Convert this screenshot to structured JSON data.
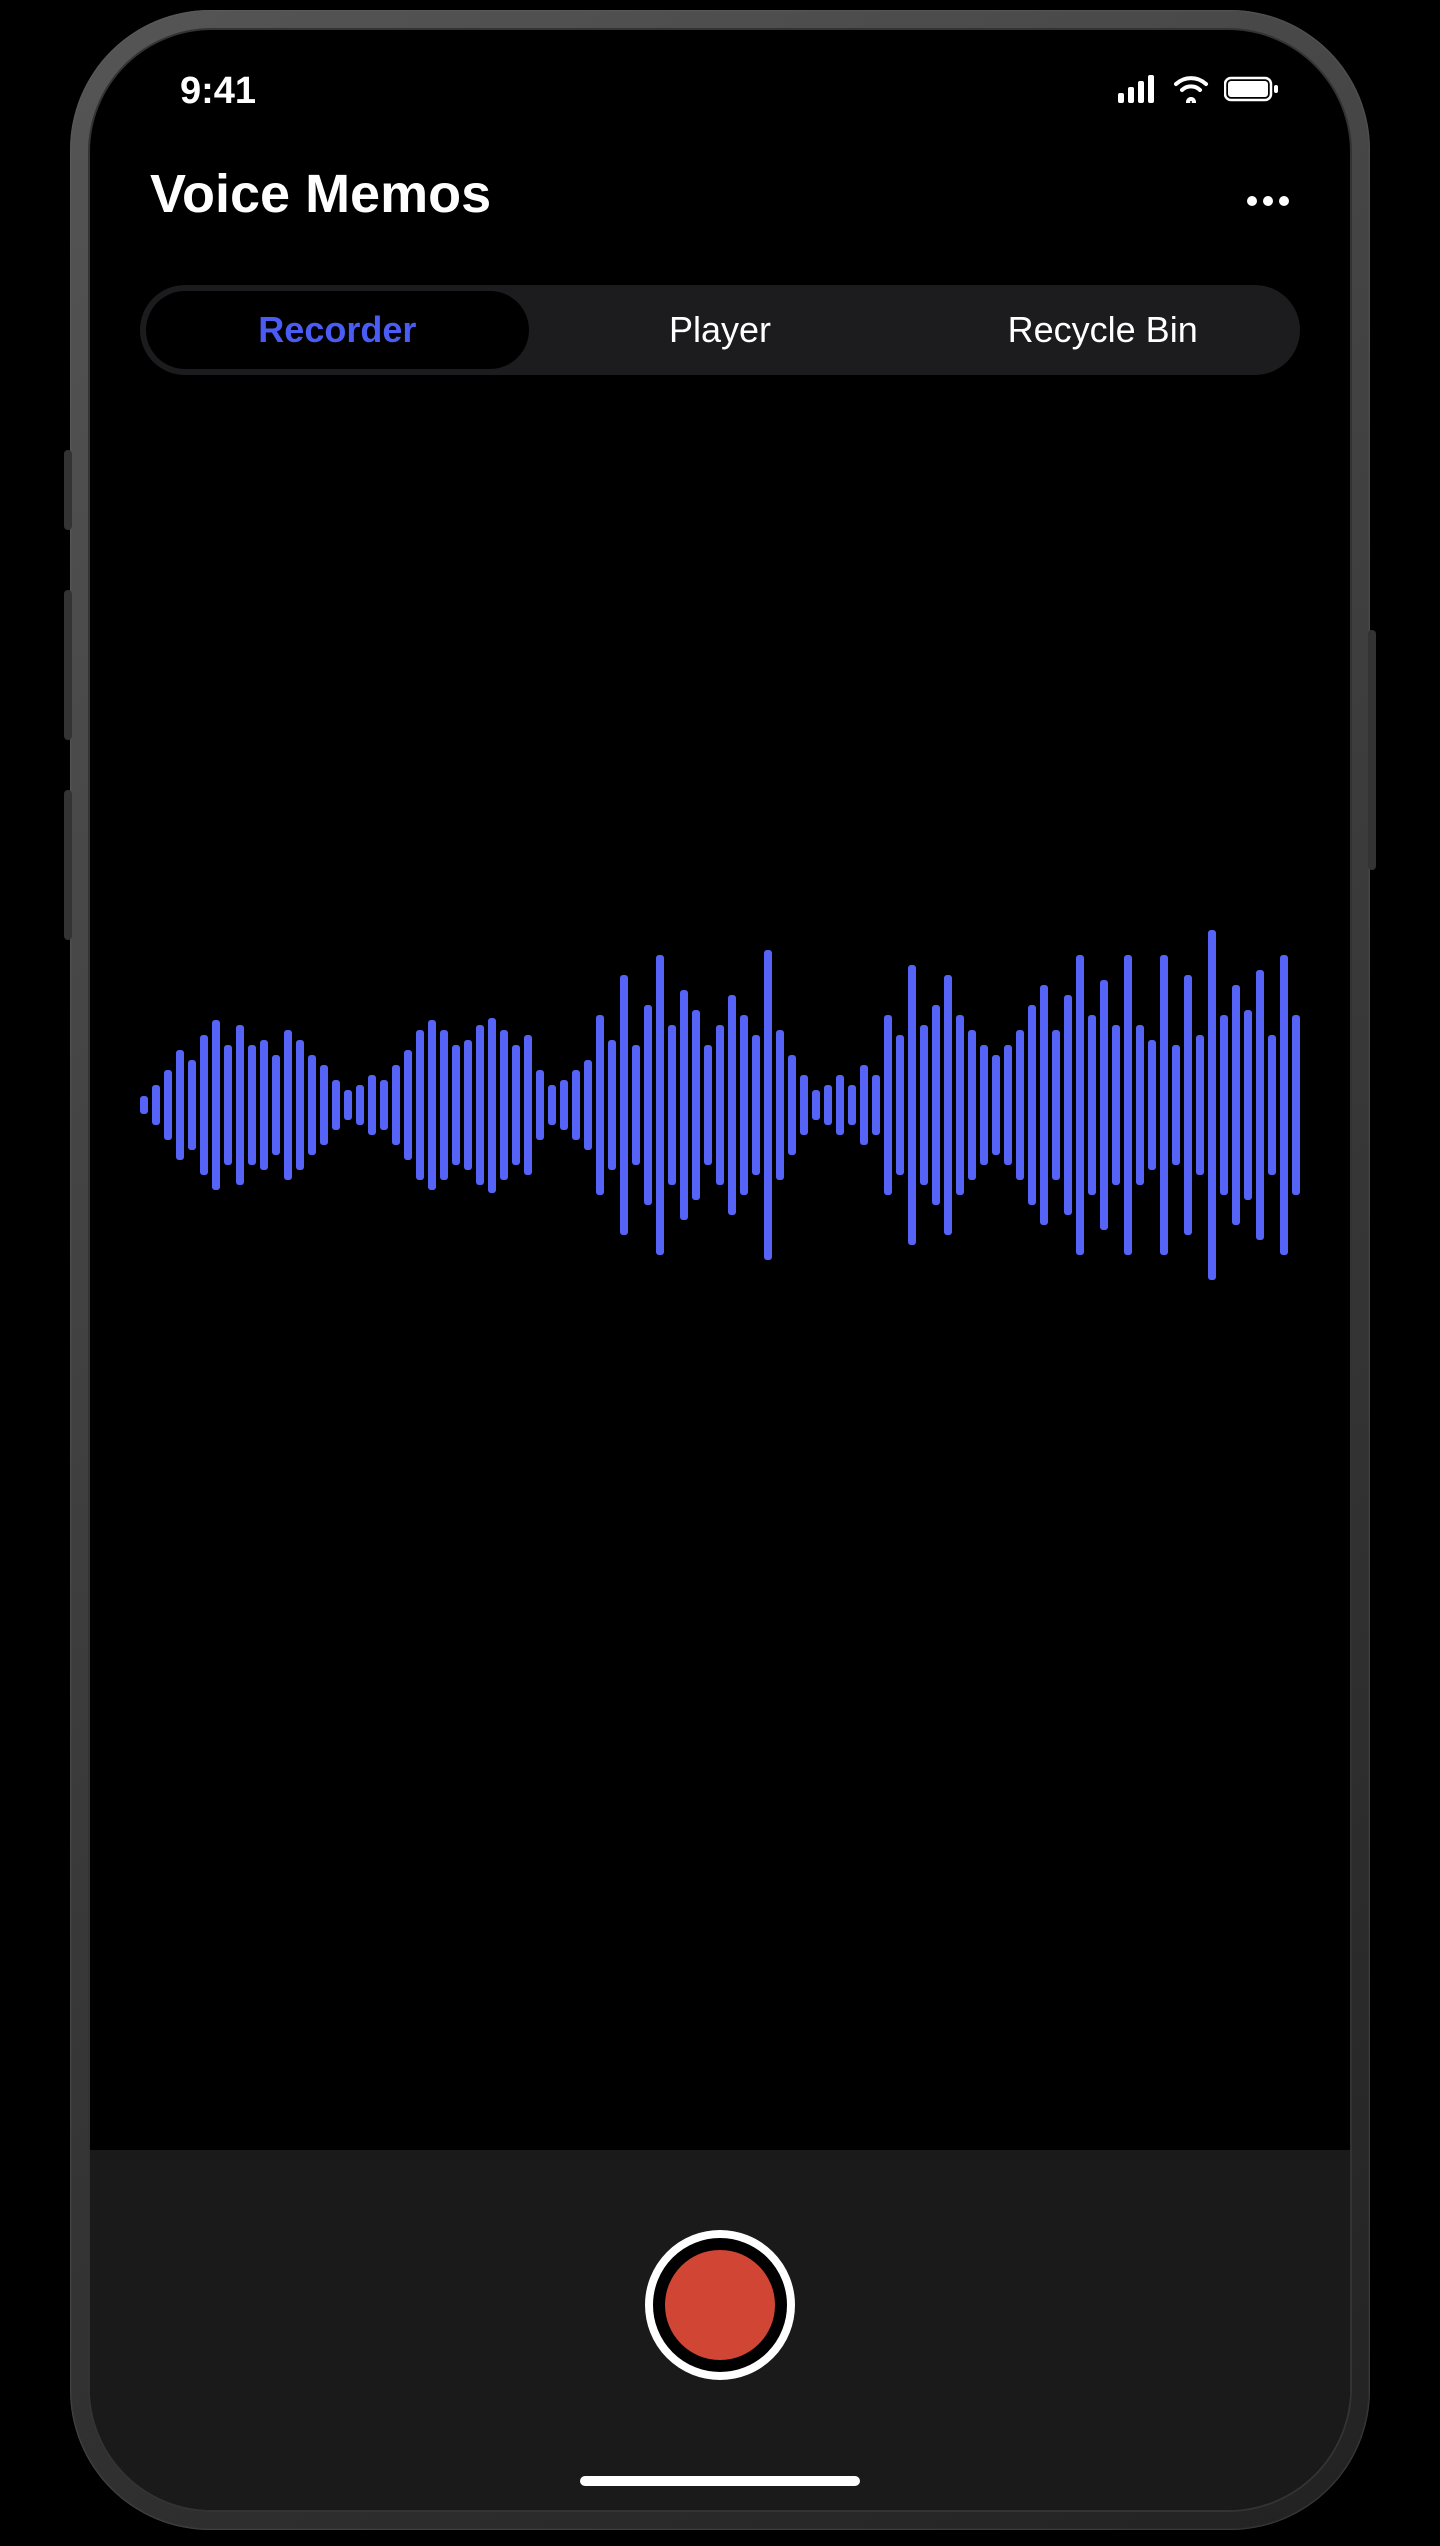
{
  "status": {
    "time": "9:41"
  },
  "header": {
    "title": "Voice Memos"
  },
  "tabs": {
    "items": [
      {
        "label": "Recorder",
        "active": true
      },
      {
        "label": "Player",
        "active": false
      },
      {
        "label": "Recycle Bin",
        "active": false
      }
    ]
  },
  "waveform": {
    "color": "#5564f6",
    "bars": [
      18,
      40,
      70,
      110,
      90,
      140,
      170,
      120,
      160,
      120,
      130,
      100,
      150,
      130,
      100,
      80,
      50,
      30,
      40,
      60,
      50,
      80,
      110,
      150,
      170,
      150,
      120,
      130,
      160,
      175,
      150,
      120,
      140,
      70,
      40,
      50,
      70,
      90,
      180,
      130,
      260,
      120,
      200,
      300,
      160,
      230,
      190,
      120,
      160,
      220,
      180,
      140,
      310,
      150,
      100,
      60,
      30,
      40,
      60,
      40,
      80,
      60,
      180,
      140,
      280,
      160,
      200,
      260,
      180,
      150,
      120,
      100,
      120,
      150,
      200,
      240,
      150,
      220,
      300,
      180,
      250,
      160,
      300,
      160,
      130,
      300,
      120,
      260,
      140,
      350,
      180,
      240,
      190,
      270,
      140,
      300,
      180
    ]
  },
  "controls": {
    "record_color": "#d14535"
  }
}
